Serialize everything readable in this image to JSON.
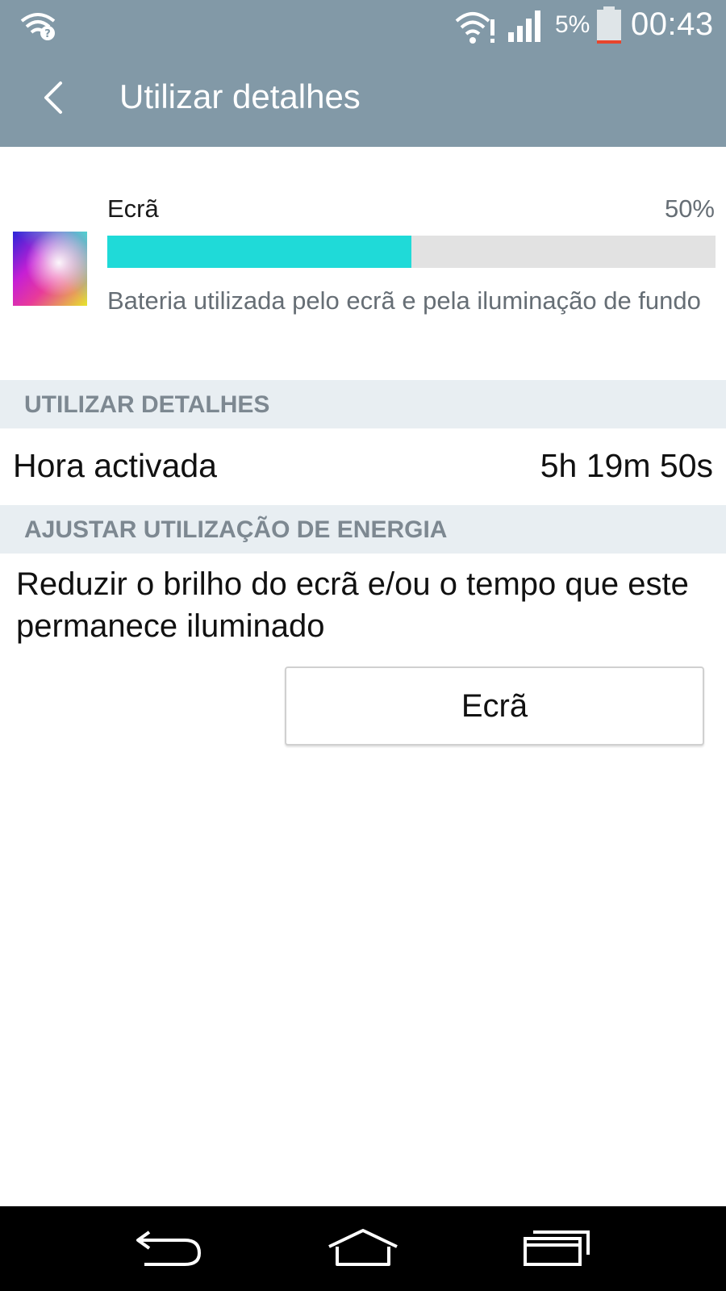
{
  "status_bar": {
    "battery_percent": "5%",
    "time": "00:43",
    "icons": [
      "wifi-question-icon",
      "wifi-warning-icon",
      "signal-icon",
      "battery-low-icon"
    ]
  },
  "app_bar": {
    "title": "Utilizar detalhes",
    "back_icon": "back-arrow-icon"
  },
  "usage_item": {
    "name": "Ecrã",
    "percent_label": "50%",
    "fill_fraction": 0.5,
    "description": "Bateria utilizada pelo ecrã e pela iluminação de fundo",
    "bar_color": "#1fdad8"
  },
  "sections": {
    "details_header": "UTILIZAR DETALHES",
    "adjust_header": "AJUSTAR UTILIZAÇÃO DE ENERGIA"
  },
  "details": {
    "label": "Hora activada",
    "value": "5h 19m 50s"
  },
  "adjust": {
    "advice": "Reduzir o brilho do ecrã e/ou o tempo que este permanece iluminado",
    "button_label": "Ecrã"
  },
  "nav_bar": {
    "icons": [
      "back-icon",
      "home-icon",
      "recents-icon"
    ]
  },
  "colors": {
    "header": "#8299a7",
    "section_bg": "#e8eef2",
    "accent": "#1fdad8"
  }
}
